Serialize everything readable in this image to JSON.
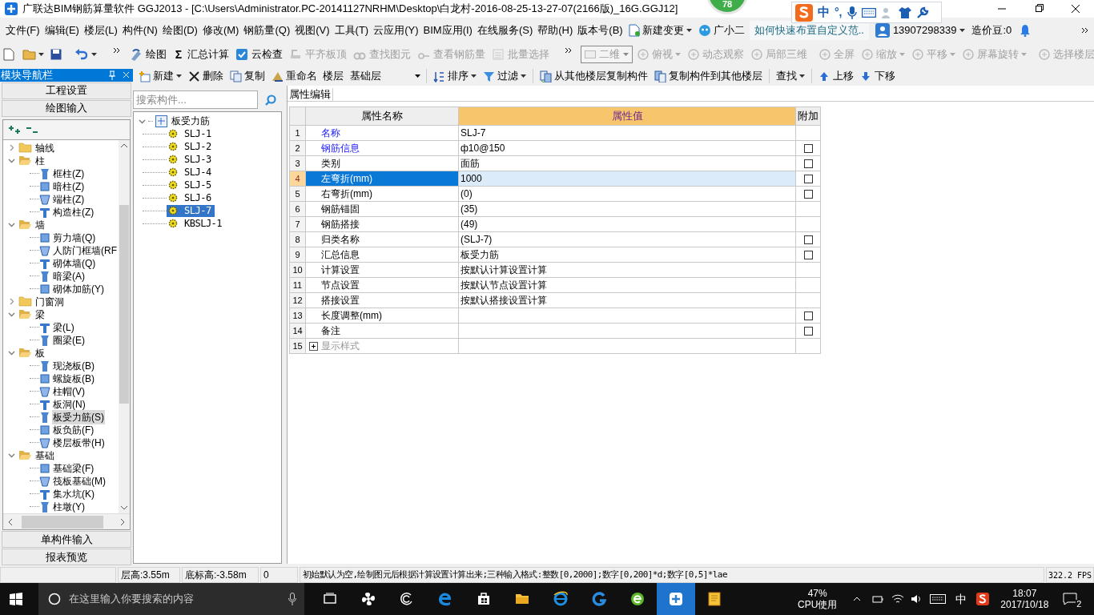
{
  "window": {
    "title": "广联达BIM钢筋算量软件 GGJ2013 - [C:\\Users\\Administrator.PC-20141127NRHM\\Desktop\\白龙村-2016-08-25-13-27-07(2166版)_16G.GGJ12]"
  },
  "score_badge": "78",
  "ime_bar": {
    "mode": "中",
    "punctuation": "°,"
  },
  "menu": [
    "文件(F)",
    "编辑(E)",
    "楼层(L)",
    "构件(N)",
    "绘图(D)",
    "修改(M)",
    "钢筋量(Q)",
    "视图(V)",
    "工具(T)",
    "云应用(Y)",
    "BIM应用(I)",
    "在线服务(S)",
    "帮助(H)",
    "版本号(B)"
  ],
  "menu_extras": {
    "change": "新建变更",
    "assistant": "广小二",
    "tip": "如何快速布置自定义范..",
    "account": "13907298339",
    "beans": "造价豆:0"
  },
  "toolbar": [
    {
      "label": "绘图",
      "disabled": false,
      "has_menu": false
    },
    {
      "label": "汇总计算",
      "icon_text": "Σ",
      "disabled": false,
      "has_menu": false
    },
    {
      "label": "云检查",
      "disabled": false,
      "has_menu": false
    },
    {
      "label": "平齐板顶",
      "disabled": true,
      "has_menu": false
    },
    {
      "label": "查找图元",
      "disabled": true,
      "has_menu": false
    },
    {
      "label": "查看钢筋量",
      "disabled": true,
      "has_menu": false
    },
    {
      "label": "批量选择",
      "disabled": true,
      "has_menu": false
    }
  ],
  "view_toolbar": {
    "view_select": "二维",
    "items": [
      {
        "label": "俯视",
        "disabled": true,
        "has_menu": true
      },
      {
        "label": "动态观察",
        "disabled": true,
        "has_menu": false
      },
      {
        "label": "局部三维",
        "disabled": true,
        "has_menu": false
      },
      {
        "label": "全屏",
        "disabled": true,
        "has_menu": false
      },
      {
        "label": "缩放",
        "disabled": true,
        "has_menu": true
      },
      {
        "label": "平移",
        "disabled": true,
        "has_menu": true
      },
      {
        "label": "屏幕旋转",
        "disabled": true,
        "has_menu": true
      },
      {
        "label": "选择楼层",
        "disabled": true,
        "has_menu": false
      }
    ]
  },
  "nav_panel": {
    "title": "模块导航栏",
    "top_buttons": [
      "工程设置",
      "绘图输入"
    ],
    "tree": [
      {
        "label": "轴线",
        "expanded": false,
        "selected": false
      },
      {
        "label": "柱",
        "expanded": true,
        "selected": false,
        "children": [
          {
            "label": "框柱(Z)",
            "selected": false
          },
          {
            "label": "暗柱(Z)",
            "selected": false
          },
          {
            "label": "端柱(Z)",
            "selected": false
          },
          {
            "label": "构造柱(Z)",
            "selected": false
          }
        ]
      },
      {
        "label": "墙",
        "expanded": true,
        "selected": false,
        "children": [
          {
            "label": "剪力墙(Q)",
            "selected": false
          },
          {
            "label": "人防门框墙(RF",
            "selected": false
          },
          {
            "label": "砌体墙(Q)",
            "selected": false
          },
          {
            "label": "暗梁(A)",
            "selected": false
          },
          {
            "label": "砌体加筋(Y)",
            "selected": false
          }
        ]
      },
      {
        "label": "门窗洞",
        "expanded": false,
        "selected": false
      },
      {
        "label": "梁",
        "expanded": true,
        "selected": false,
        "children": [
          {
            "label": "梁(L)",
            "selected": false
          },
          {
            "label": "圈梁(E)",
            "selected": false
          }
        ]
      },
      {
        "label": "板",
        "expanded": true,
        "selected": false,
        "children": [
          {
            "label": "现浇板(B)",
            "selected": false
          },
          {
            "label": "螺旋板(B)",
            "selected": false
          },
          {
            "label": "柱帽(V)",
            "selected": false
          },
          {
            "label": "板洞(N)",
            "selected": false
          },
          {
            "label": "板受力筋(S)",
            "selected": true
          },
          {
            "label": "板负筋(F)",
            "selected": false
          },
          {
            "label": "楼层板带(H)",
            "selected": false
          }
        ]
      },
      {
        "label": "基础",
        "expanded": true,
        "selected": false,
        "children": [
          {
            "label": "基础梁(F)",
            "selected": false
          },
          {
            "label": "筏板基础(M)",
            "selected": false
          },
          {
            "label": "集水坑(K)",
            "selected": false
          },
          {
            "label": "柱墩(Y)",
            "selected": false
          }
        ]
      }
    ],
    "bottom_buttons": [
      "单构件输入",
      "报表预览"
    ]
  },
  "component_toolbar": [
    {
      "label": "新建",
      "has_menu": true
    },
    {
      "label": "删除",
      "has_menu": false
    },
    {
      "label": "复制",
      "has_menu": false
    },
    {
      "label": "重命名",
      "has_menu": false
    },
    {
      "kind": "floor",
      "label": "楼层",
      "value": "基础层"
    },
    {
      "label": "排序",
      "has_menu": true
    },
    {
      "label": "过滤",
      "has_menu": true
    },
    {
      "label": "从其他楼层复制构件",
      "has_menu": false
    },
    {
      "label": "复制构件到其他楼层",
      "has_menu": false
    },
    {
      "label": "查找",
      "has_menu": true
    },
    {
      "label": "上移",
      "has_menu": false
    },
    {
      "label": "下移",
      "has_menu": false
    }
  ],
  "component_list": {
    "search_placeholder": "搜索构件...",
    "tree": [
      {
        "label": "板受力筋",
        "expanded": true,
        "selected": false,
        "children": [
          {
            "label": "SLJ-1",
            "selected": false
          },
          {
            "label": "SLJ-2",
            "selected": false
          },
          {
            "label": "SLJ-3",
            "selected": false
          },
          {
            "label": "SLJ-4",
            "selected": false
          },
          {
            "label": "SLJ-5",
            "selected": false
          },
          {
            "label": "SLJ-6",
            "selected": false
          },
          {
            "label": "SLJ-7",
            "selected": true
          },
          {
            "label": "KBSLJ-1",
            "selected": false
          }
        ]
      }
    ]
  },
  "property_editor": {
    "tab": "属性编辑",
    "columns": [
      "属性名称",
      "属性值",
      "附加"
    ],
    "rows": [
      {
        "index": "1",
        "name": "名称",
        "value": "SLJ-7",
        "emphasized": true,
        "selected": false
      },
      {
        "index": "2",
        "name": "钢筋信息",
        "value": "ф10@150",
        "emphasized": true,
        "selected": false,
        "checked": false
      },
      {
        "index": "3",
        "name": "类别",
        "value": "面筋",
        "emphasized": false,
        "selected": false,
        "checked": false
      },
      {
        "index": "4",
        "name": "左弯折(mm)",
        "value": "1000",
        "emphasized": false,
        "selected": true,
        "checked": false
      },
      {
        "index": "5",
        "name": "右弯折(mm)",
        "value": "(0)",
        "emphasized": false,
        "selected": false,
        "checked": false
      },
      {
        "index": "6",
        "name": "钢筋锚固",
        "value": "(35)",
        "emphasized": false,
        "selected": false
      },
      {
        "index": "7",
        "name": "钢筋搭接",
        "value": "(49)",
        "emphasized": false,
        "selected": false
      },
      {
        "index": "8",
        "name": "归类名称",
        "value": "(SLJ-7)",
        "emphasized": false,
        "selected": false,
        "checked": false
      },
      {
        "index": "9",
        "name": "汇总信息",
        "value": "板受力筋",
        "emphasized": false,
        "selected": false,
        "checked": false
      },
      {
        "index": "10",
        "name": "计算设置",
        "value": "按默认计算设置计算",
        "emphasized": false,
        "selected": false
      },
      {
        "index": "11",
        "name": "节点设置",
        "value": "按默认节点设置计算",
        "emphasized": false,
        "selected": false
      },
      {
        "index": "12",
        "name": "搭接设置",
        "value": "按默认搭接设置计算",
        "emphasized": false,
        "selected": false
      },
      {
        "index": "13",
        "name": "长度调整(mm)",
        "emphasized": false,
        "selected": false,
        "checked": false
      },
      {
        "index": "14",
        "name": "备注",
        "emphasized": false,
        "selected": false,
        "checked": false
      },
      {
        "index": "15",
        "name": "显示样式",
        "kind": "group",
        "expanded": false,
        "emphasized": false,
        "selected": false
      }
    ]
  },
  "status_bar": {
    "floor_height": "层高:3.55m",
    "base_elevation": "底标高:-3.58m",
    "count": "0",
    "hint": "初始默认为空,绘制图元后根据计算设置计算出来;三种输入格式:整数[0,2000];数字[0,200]*d;数字[0,5]*lae",
    "fps": "322.2 FPS"
  },
  "taskbar": {
    "search_placeholder": "在这里输入你要搜索的内容",
    "apps": [
      {
        "selected": false
      },
      {
        "selected": false
      },
      {
        "selected": false
      },
      {
        "selected": false
      },
      {
        "selected": false
      },
      {
        "selected": false
      },
      {
        "selected": false
      },
      {
        "selected": false
      },
      {
        "selected": false
      },
      {
        "selected": true
      },
      {
        "selected": false
      }
    ],
    "cpu": "47%",
    "cpu_label": "CPU使用",
    "ime": "中",
    "time": "18:07",
    "date": "2017/10/18",
    "notifications": "2"
  }
}
